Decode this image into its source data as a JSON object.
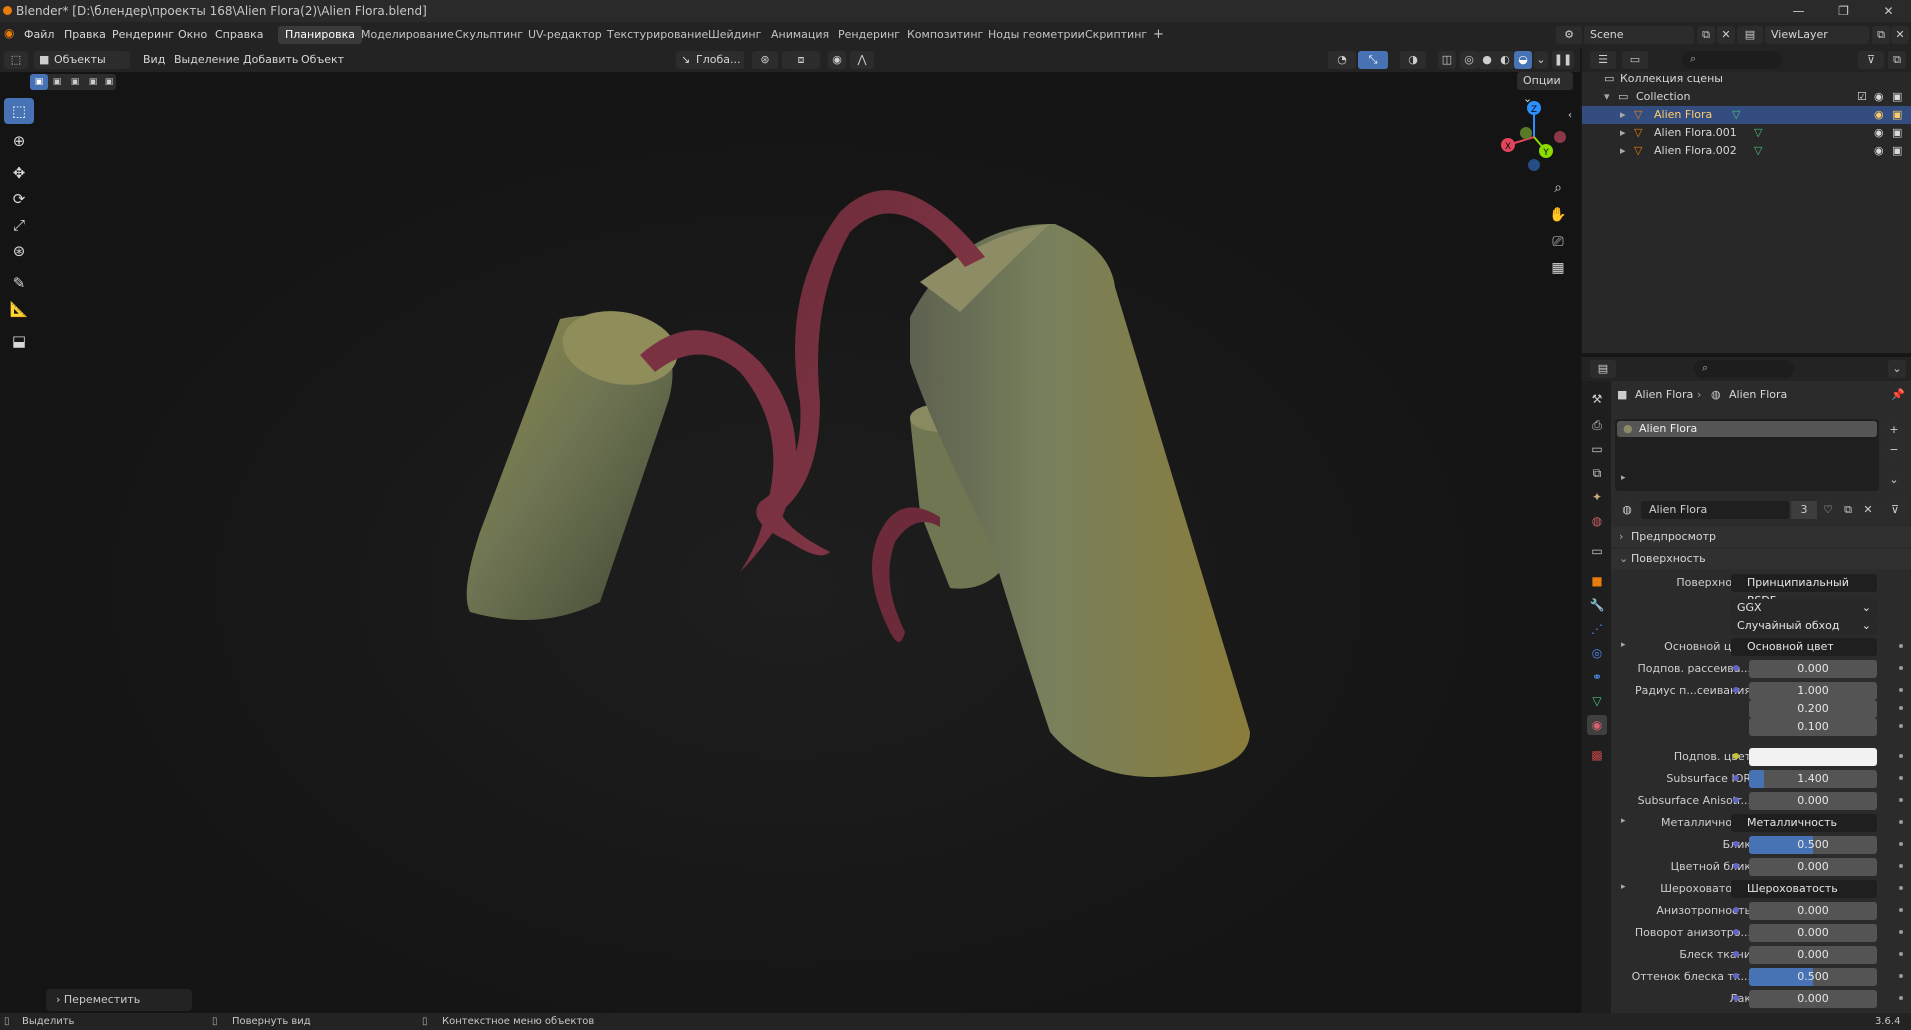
{
  "window": {
    "title": "Blender* [D:\\блендер\\проекты 168\\Alien Flora(2)\\Alien Flora.blend]",
    "minimize_glyph": "—",
    "maximize_glyph": "❐",
    "close_glyph": "✕"
  },
  "menubar": {
    "items": [
      "Файл",
      "Правка",
      "Рендеринг",
      "Окно",
      "Справка"
    ],
    "workspaces": [
      "Планировка",
      "Моделирование",
      "Скульптинг",
      "UV-редактор",
      "Текстурирование",
      "Шейдинг",
      "Анимация",
      "Рендеринг",
      "Композитинг",
      "Ноды геометрии",
      "Скриптинг"
    ],
    "active_workspace": "Планировка",
    "add_tab_glyph": "+",
    "scene": "Scene",
    "view_layer": "ViewLayer"
  },
  "viewport_header": {
    "mode": "Объекты",
    "menus": [
      "Вид",
      "Выделение",
      "Добавить",
      "Объект"
    ],
    "orientation": "Глоба...",
    "options_label": "Опции"
  },
  "viewport": {
    "move_panel": "Переместить",
    "gizmo": {
      "x": "X",
      "y": "Y",
      "z": "Z"
    }
  },
  "outliner": {
    "root": "Коллекция сцены",
    "collection": "Collection",
    "objects": [
      {
        "name": "Alien Flora",
        "selected": true
      },
      {
        "name": "Alien Flora.001",
        "selected": false
      },
      {
        "name": "Alien Flora.002",
        "selected": false
      }
    ]
  },
  "properties": {
    "breadcrumb_object": "Alien Flora",
    "breadcrumb_material": "Alien Flora",
    "slot_name": "Alien Flora",
    "material_name": "Alien Flora",
    "user_count": "3",
    "sections": {
      "preview": "Предпросмотр",
      "surface": "Поверхность"
    },
    "surface_label": "Поверхность",
    "surface_value": "Принципиальный BSDF",
    "distribution": "GGX",
    "subsurface_method": "Случайный обход",
    "rows": [
      {
        "label": "Основной цвет",
        "value": "Основной цвет",
        "kind": "link",
        "expand": true
      },
      {
        "label": "Подпов. рассеива...",
        "value": "0.000",
        "kind": "num",
        "fill": 0
      },
      {
        "label": "Радиус п...сеивания",
        "value": "1.000",
        "kind": "num",
        "fill": 0
      },
      {
        "label": "",
        "value": "0.200",
        "kind": "num",
        "fill": 0
      },
      {
        "label": "",
        "value": "0.100",
        "kind": "num",
        "fill": 0
      },
      {
        "label": "Подпов. цвет",
        "value": "",
        "kind": "color"
      },
      {
        "label": "Subsurface IOR",
        "value": "1.400",
        "kind": "num",
        "fill": 0.12
      },
      {
        "label": "Subsurface Anisotr...",
        "value": "0.000",
        "kind": "num",
        "fill": 0
      },
      {
        "label": "Металличность",
        "value": "Металличность",
        "kind": "link",
        "expand": true
      },
      {
        "label": "Блик",
        "value": "0.500",
        "kind": "num",
        "fill": 0.5
      },
      {
        "label": "Цветной блик",
        "value": "0.000",
        "kind": "num",
        "fill": 0
      },
      {
        "label": "Шероховатость",
        "value": "Шероховатость",
        "kind": "link",
        "expand": true
      },
      {
        "label": "Анизотропность",
        "value": "0.000",
        "kind": "num",
        "fill": 0
      },
      {
        "label": "Поворот анизотро...",
        "value": "0.000",
        "kind": "num",
        "fill": 0
      },
      {
        "label": "Блеск ткани",
        "value": "0.000",
        "kind": "num",
        "fill": 0
      },
      {
        "label": "Оттенок блеска тк...",
        "value": "0.500",
        "kind": "num",
        "fill": 0.5
      },
      {
        "label": "Лак",
        "value": "0.000",
        "kind": "num",
        "fill": 0
      }
    ]
  },
  "statusbar": {
    "select": "Выделить",
    "rotate": "Повернуть вид",
    "context_menu": "Контекстное меню объектов",
    "version": "3.6.4"
  },
  "colors": {
    "accent": "#4772b3",
    "selected_row": "#334d80",
    "selected_text": "#ffcc66",
    "object_orange": "#e87d0d",
    "mesh_green": "#44c37a",
    "socket_yellow": "#c7c729",
    "socket_purple": "#6363c7",
    "gizmo_x": "#e2445b",
    "gizmo_y": "#8bdc00",
    "gizmo_z": "#2c8fff"
  },
  "icons": [
    "blender-logo-icon",
    "select-box-icon",
    "cursor-icon",
    "move-icon",
    "rotate-icon",
    "scale-icon",
    "transform-icon",
    "annotate-icon",
    "measure-icon",
    "add-cube-icon",
    "zoom-icon",
    "hand-pan-icon",
    "camera-icon",
    "grid-icon",
    "eye-icon",
    "camera-render-icon",
    "mesh-icon",
    "material-icon",
    "wrench-icon",
    "search-icon",
    "filter-icon",
    "pin-icon"
  ]
}
